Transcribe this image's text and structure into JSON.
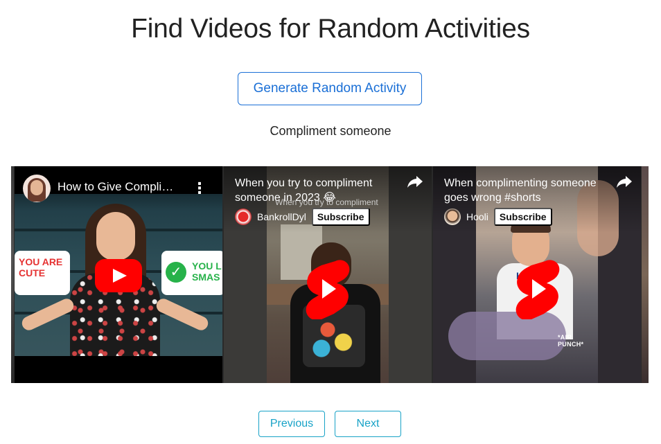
{
  "page": {
    "title": "Find Videos for Random Activities",
    "generate_button_label": "Generate Random Activity",
    "activity": "Compliment someone"
  },
  "videos": [
    {
      "title": "How to Give Compli…",
      "thumbnail_badges": [
        "YOU ARE CUTE",
        "YOU L SMAS"
      ],
      "type": "video"
    },
    {
      "title": "When you try to compliment someone in 2023 😂",
      "overlay_caption": "When you try to compliment",
      "channel": "BankrollDyl",
      "subscribe_label": "Subscribe",
      "type": "short"
    },
    {
      "title": "When complimenting someone goes wrong #shorts",
      "channel": "Hooli",
      "subscribe_label": "Subscribe",
      "scene_caption": "*AIR PUNCH*",
      "shirt_text": "HILF",
      "type": "short"
    }
  ],
  "pagination": {
    "previous_label": "Previous",
    "next_label": "Next"
  },
  "colors": {
    "primary": "#1a6fd6",
    "nav": "#17a2c7",
    "youtube_red": "#ff0000",
    "text": "#222222"
  },
  "icons": [
    "play-icon",
    "shorts-icon",
    "share-icon",
    "more-vert-icon"
  ]
}
